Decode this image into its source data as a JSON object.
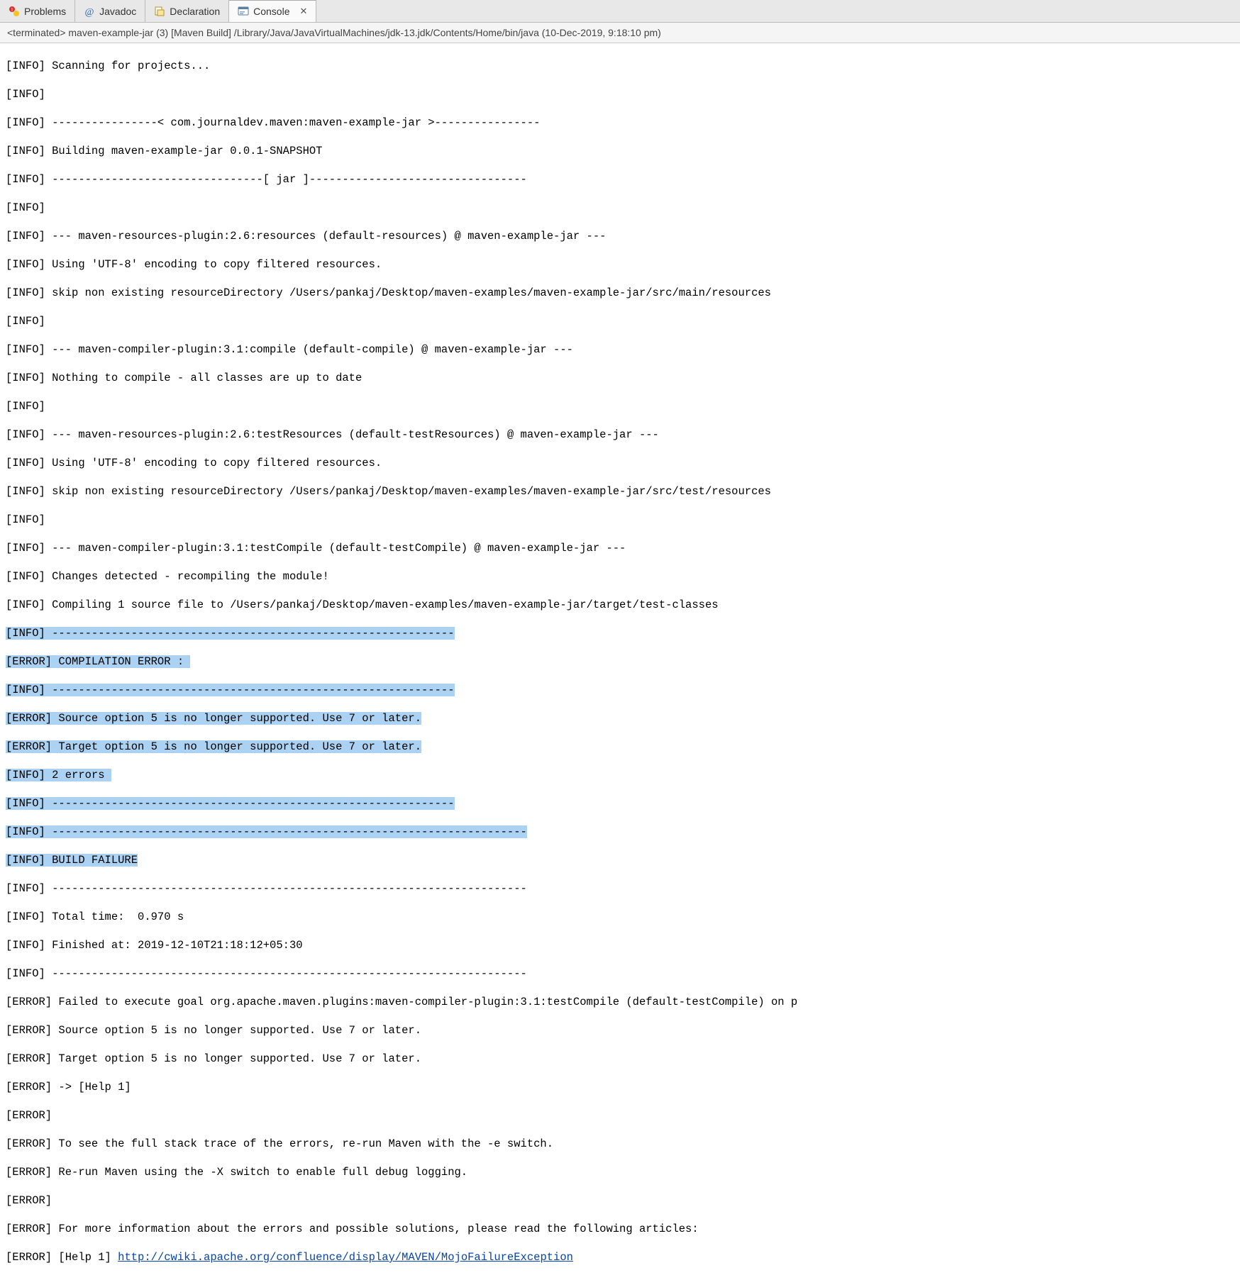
{
  "tabs": {
    "problems": "Problems",
    "javadoc": "Javadoc",
    "declaration": "Declaration",
    "console": "Console"
  },
  "status": "<terminated> maven-example-jar (3) [Maven Build] /Library/Java/JavaVirtualMachines/jdk-13.jdk/Contents/Home/bin/java (10-Dec-2019, 9:18:10 pm)",
  "lines": {
    "l0": "[INFO] Scanning for projects...",
    "l1": "[INFO] ",
    "l2": "[INFO] ----------------< com.journaldev.maven:maven-example-jar >----------------",
    "l3": "[INFO] Building maven-example-jar 0.0.1-SNAPSHOT",
    "l4": "[INFO] --------------------------------[ jar ]---------------------------------",
    "l5": "[INFO] ",
    "l6": "[INFO] --- maven-resources-plugin:2.6:resources (default-resources) @ maven-example-jar ---",
    "l7": "[INFO] Using 'UTF-8' encoding to copy filtered resources.",
    "l8": "[INFO] skip non existing resourceDirectory /Users/pankaj/Desktop/maven-examples/maven-example-jar/src/main/resources",
    "l9": "[INFO] ",
    "l10": "[INFO] --- maven-compiler-plugin:3.1:compile (default-compile) @ maven-example-jar ---",
    "l11": "[INFO] Nothing to compile - all classes are up to date",
    "l12": "[INFO] ",
    "l13": "[INFO] --- maven-resources-plugin:2.6:testResources (default-testResources) @ maven-example-jar ---",
    "l14": "[INFO] Using 'UTF-8' encoding to copy filtered resources.",
    "l15": "[INFO] skip non existing resourceDirectory /Users/pankaj/Desktop/maven-examples/maven-example-jar/src/test/resources",
    "l16": "[INFO] ",
    "l17": "[INFO] --- maven-compiler-plugin:3.1:testCompile (default-testCompile) @ maven-example-jar ---",
    "l18": "[INFO] Changes detected - recompiling the module!",
    "l19": "[INFO] Compiling 1 source file to /Users/pankaj/Desktop/maven-examples/maven-example-jar/target/test-classes",
    "l20": "[INFO] -------------------------------------------------------------",
    "l21": "[ERROR] COMPILATION ERROR : ",
    "l22": "[INFO] -------------------------------------------------------------",
    "l23": "[ERROR] Source option 5 is no longer supported. Use 7 or later.",
    "l24": "[ERROR] Target option 5 is no longer supported. Use 7 or later.",
    "l25": "[INFO] 2 errors ",
    "l26": "[INFO] -------------------------------------------------------------",
    "l27": "[INFO] ------------------------------------------------------------------------",
    "l28": "[INFO] BUILD FAILURE",
    "l29": "[INFO] ------------------------------------------------------------------------",
    "l30": "[INFO] Total time:  0.970 s",
    "l31": "[INFO] Finished at: 2019-12-10T21:18:12+05:30",
    "l32": "[INFO] ------------------------------------------------------------------------",
    "l33": "[ERROR] Failed to execute goal org.apache.maven.plugins:maven-compiler-plugin:3.1:testCompile (default-testCompile) on p",
    "l34": "[ERROR] Source option 5 is no longer supported. Use 7 or later.",
    "l35": "[ERROR] Target option 5 is no longer supported. Use 7 or later.",
    "l36": "[ERROR] -> [Help 1]",
    "l37": "[ERROR] ",
    "l38": "[ERROR] To see the full stack trace of the errors, re-run Maven with the -e switch.",
    "l39": "[ERROR] Re-run Maven using the -X switch to enable full debug logging.",
    "l40": "[ERROR] ",
    "l41": "[ERROR] For more information about the errors and possible solutions, please read the following articles:",
    "l42a": "[ERROR] [Help 1] ",
    "l42b": "http://cwiki.apache.org/confluence/display/MAVEN/MojoFailureException"
  }
}
